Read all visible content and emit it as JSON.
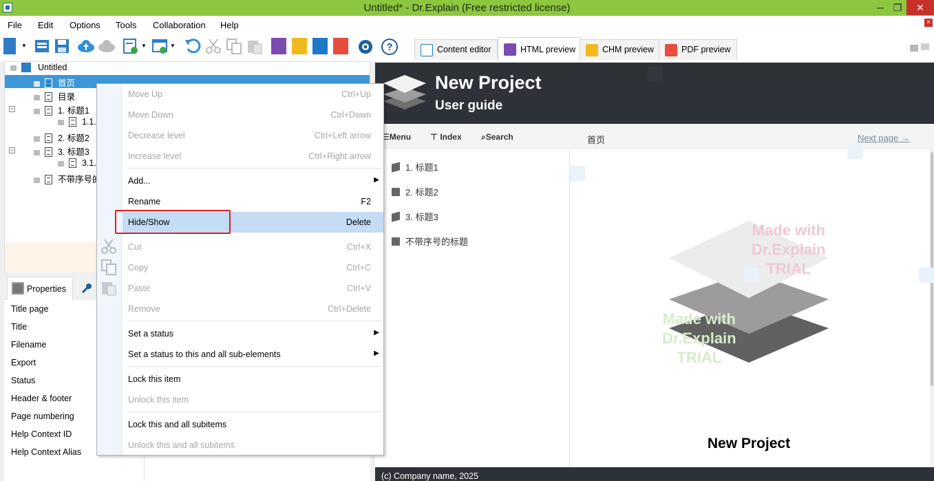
{
  "window": {
    "title": "Untitled* - Dr.Explain (Free restricted license)",
    "minimize": "─",
    "restore": "❐",
    "close": "✕"
  },
  "menu": [
    "File",
    "Edit",
    "Options",
    "Tools",
    "Collaboration",
    "Help"
  ],
  "toolbar": {
    "icons": [
      "new-project-icon",
      "open-icon",
      "save-icon",
      "cloud-upload-icon",
      "cloud-download-icon",
      "import-icon",
      "export-icon",
      "undo-icon",
      "cut-icon",
      "copy-icon",
      "paste-icon",
      "html-icon",
      "chm-icon",
      "word-icon",
      "pdf-icon",
      "settings-icon",
      "help-icon"
    ],
    "help_glyph": "?"
  },
  "view_tabs": {
    "content_editor": "Content editor",
    "html_preview": "HTML preview",
    "chm_preview": "CHM preview",
    "pdf_preview": "PDF preview"
  },
  "tree": {
    "root": "Untitled",
    "items": [
      "首页",
      "目录",
      "1. 标题1",
      "1.1.",
      "2. 标题2",
      "3. 标题3",
      "3.1.",
      "不带序号的"
    ],
    "collapse_glyph": "−"
  },
  "properties": {
    "tab_label": "Properties",
    "rows": [
      "Title page",
      "Title",
      "Filename",
      "Export",
      "Status",
      "Header & footer",
      "Page numbering",
      "Help Context ID",
      "Help Context Alias"
    ]
  },
  "context_menu": {
    "items": [
      {
        "label": "Move Up",
        "shortcut": "Ctrl+Up"
      },
      {
        "label": "Move Down",
        "shortcut": "Ctrl+Down"
      },
      {
        "label": "Decrease level",
        "shortcut": "Ctrl+Left arrow"
      },
      {
        "label": "Increase level",
        "shortcut": "Ctrl+Right arrow"
      },
      {
        "label": "Add...",
        "shortcut": ""
      },
      {
        "label": "Rename",
        "shortcut": "F2"
      },
      {
        "label": "Hide/Show",
        "shortcut": "Delete"
      },
      {
        "label": "Cut",
        "shortcut": "Ctrl+X"
      },
      {
        "label": "Copy",
        "shortcut": "Ctrl+C"
      },
      {
        "label": "Paste",
        "shortcut": "Ctrl+V"
      },
      {
        "label": "Remove",
        "shortcut": "Ctrl+Delete"
      },
      {
        "label": "Set a status",
        "shortcut": ""
      },
      {
        "label": "Set a status to this and all sub-elements",
        "shortcut": ""
      },
      {
        "label": "Lock this item",
        "shortcut": ""
      },
      {
        "label": "Unlock this item",
        "shortcut": ""
      },
      {
        "label": "Lock this and all subitems",
        "shortcut": ""
      },
      {
        "label": "Unlock this and all subitems",
        "shortcut": ""
      }
    ],
    "submenu_arrow": "▶"
  },
  "preview": {
    "project_title": "New Project",
    "subtitle": "User guide",
    "nav": {
      "menu": "Menu",
      "index": "Index",
      "search": "Search"
    },
    "page_title": "首页",
    "next_page": "Next page →",
    "toc": [
      "1. 标题1",
      "2. 标题2",
      "3. 标题3",
      "不带序号的标题"
    ],
    "watermark": [
      "Made with",
      "Dr.Explain",
      "TRIAL"
    ],
    "content_heading": "New Project",
    "footer": "(c) Company name, 2025"
  }
}
